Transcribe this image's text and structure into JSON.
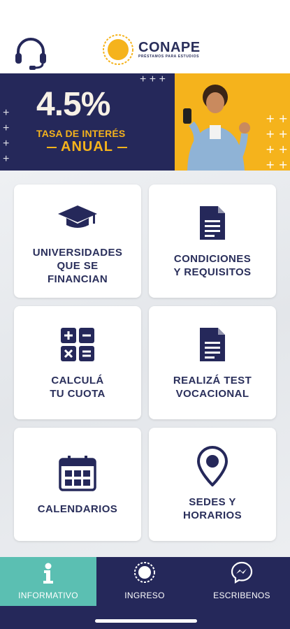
{
  "header": {
    "support_icon": "headset-icon",
    "logo": {
      "name": "CONAPE",
      "tagline": "PRÉSTAMOS PARA ESTUDIOS"
    }
  },
  "banner": {
    "rate": "4.5%",
    "line1": "TASA DE INTERÉS",
    "line2": "ANUAL",
    "accent_color": "#f5b31c",
    "bg_color": "#25285a"
  },
  "cards": [
    {
      "icon": "graduation-cap-icon",
      "lines": [
        "UNIVERSIDADES",
        "QUE SE",
        "FINANCIAN"
      ]
    },
    {
      "icon": "document-icon",
      "lines": [
        "CONDICIONES",
        "Y REQUISITOS"
      ]
    },
    {
      "icon": "calculator-icon",
      "lines": [
        "CALCULÁ",
        "TU CUOTA"
      ]
    },
    {
      "icon": "document-icon",
      "lines": [
        "REALIZÁ TEST",
        "VOCACIONAL"
      ]
    },
    {
      "icon": "calendar-icon",
      "lines": [
        "CALENDARIOS"
      ]
    },
    {
      "icon": "location-pin-icon",
      "lines": [
        "SEDES Y",
        "HORARIOS"
      ]
    }
  ],
  "tabs": [
    {
      "label": "INFORMATIVO",
      "icon": "info-icon",
      "active": true
    },
    {
      "label": "INGRESO",
      "icon": "sun-icon",
      "active": false
    },
    {
      "label": "ESCRIBENOS",
      "icon": "messenger-icon",
      "active": false
    }
  ]
}
